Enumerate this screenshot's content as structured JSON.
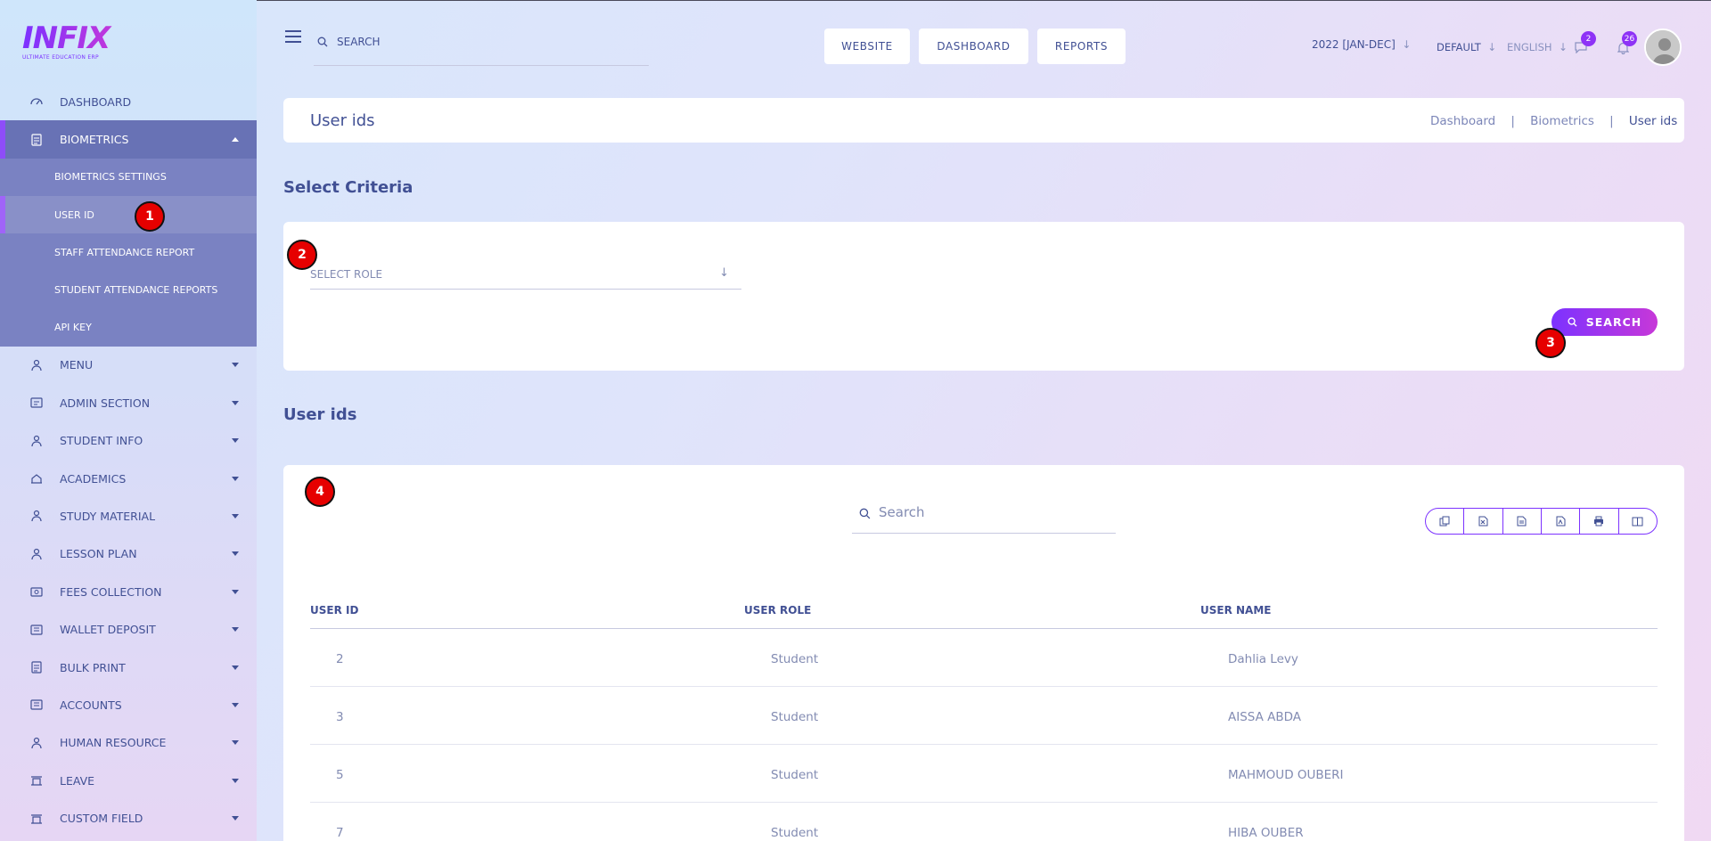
{
  "logo": {
    "word": "INFIX",
    "tagline": "ULTIMATE EDUCATION ERP"
  },
  "sidebar": {
    "items": [
      {
        "label": "DASHBOARD",
        "icon": "dashboard-icon"
      },
      {
        "label": "BIOMETRICS",
        "icon": "biometrics-icon",
        "active": true,
        "children": [
          {
            "label": "BIOMETRICS SETTINGS"
          },
          {
            "label": "USER ID",
            "current": true
          },
          {
            "label": "STAFF ATTENDANCE REPORT"
          },
          {
            "label": "STUDENT ATTENDANCE REPORTS"
          },
          {
            "label": "API KEY"
          }
        ]
      },
      {
        "label": "MENU",
        "icon": "menu-icon"
      },
      {
        "label": "ADMIN SECTION",
        "icon": "admin-icon"
      },
      {
        "label": "STUDENT INFO",
        "icon": "student-icon"
      },
      {
        "label": "ACADEMICS",
        "icon": "academics-icon"
      },
      {
        "label": "STUDY MATERIAL",
        "icon": "study-material-icon"
      },
      {
        "label": "LESSON PLAN",
        "icon": "lesson-plan-icon"
      },
      {
        "label": "FEES COLLECTION",
        "icon": "fees-icon"
      },
      {
        "label": "WALLET DEPOSIT",
        "icon": "wallet-icon"
      },
      {
        "label": "BULK PRINT",
        "icon": "print-icon"
      },
      {
        "label": "ACCOUNTS",
        "icon": "accounts-icon"
      },
      {
        "label": "HUMAN RESOURCE",
        "icon": "hr-icon"
      },
      {
        "label": "LEAVE",
        "icon": "leave-icon"
      },
      {
        "label": "CUSTOM FIELD",
        "icon": "custom-field-icon"
      }
    ]
  },
  "header": {
    "search_placeholder": "SEARCH",
    "buttons": [
      "WEBSITE",
      "DASHBOARD",
      "REPORTS"
    ],
    "session": "2022 [JAN-DEC]",
    "theme": "DEFAULT",
    "language": "ENGLISH",
    "message_count": "2",
    "notification_count": "26"
  },
  "page": {
    "title": "User ids",
    "breadcrumb": [
      "Dashboard",
      "Biometrics",
      "User ids"
    ]
  },
  "criteria": {
    "heading": "Select Criteria",
    "role_placeholder": "SELECT ROLE",
    "search_label": "SEARCH"
  },
  "table": {
    "heading": "User ids",
    "search_placeholder": "Search",
    "columns": [
      "USER ID",
      "USER ROLE",
      "USER NAME"
    ],
    "rows": [
      {
        "id": "2",
        "role": "Student",
        "name": "Dahlia Levy"
      },
      {
        "id": "3",
        "role": "Student",
        "name": "AISSA ABDA"
      },
      {
        "id": "5",
        "role": "Student",
        "name": "MAHMOUD OUBERI"
      },
      {
        "id": "7",
        "role": "Student",
        "name": "HIBA OUBER"
      }
    ],
    "export_icons": [
      "copy-icon",
      "excel-icon",
      "csv-icon",
      "pdf-icon",
      "print-icon",
      "columns-icon"
    ]
  },
  "markers": [
    "1",
    "2",
    "3",
    "4"
  ],
  "colors": {
    "accent": "#7c32ff",
    "accent2": "#c738d8",
    "text": "#415094",
    "marker": "#e60000"
  }
}
